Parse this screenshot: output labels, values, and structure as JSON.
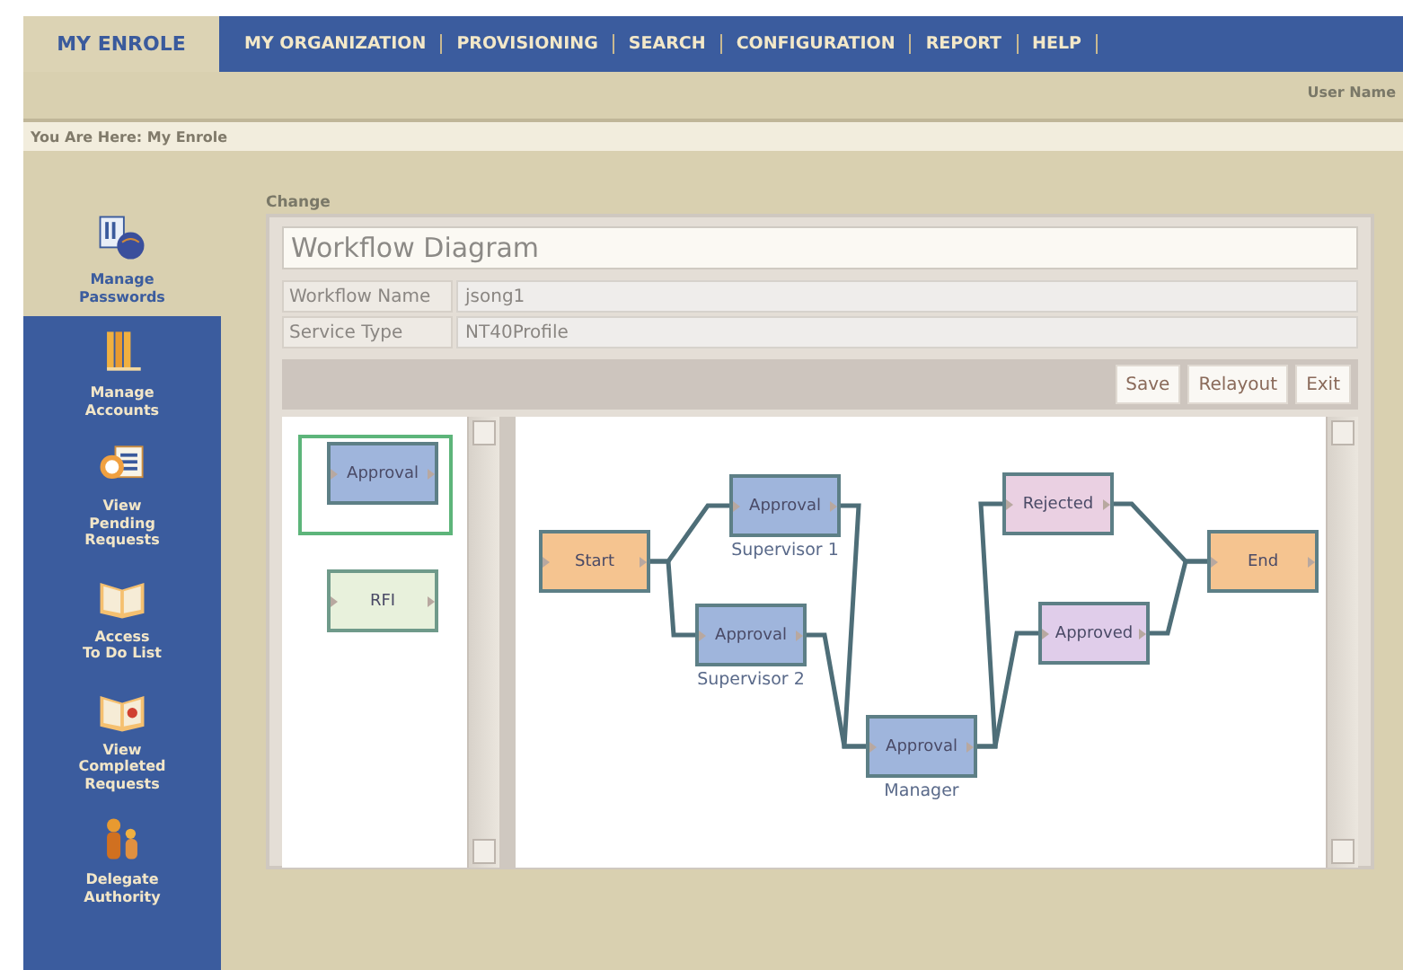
{
  "header": {
    "logo_tab": "MY ENROLE",
    "nav": [
      "MY ORGANIZATION",
      "PROVISIONING",
      "SEARCH",
      "CONFIGURATION",
      "REPORT",
      "HELP"
    ],
    "user": "User Name"
  },
  "breadcrumb": "You Are Here: My Enrole",
  "sidebar": {
    "items": [
      {
        "label": "Manage\nPasswords",
        "selected": true
      },
      {
        "label": "Manage\nAccounts",
        "selected": false
      },
      {
        "label": "View\nPending\nRequests",
        "selected": false
      },
      {
        "label": "Access\nTo Do List",
        "selected": false
      },
      {
        "label": "View\nCompleted\nRequests",
        "selected": false
      },
      {
        "label": "Delegate\nAuthority",
        "selected": false
      }
    ]
  },
  "page_heading": "Change",
  "workflow": {
    "title": "Workflow Diagram",
    "fields": [
      {
        "label": "Workflow Name",
        "value": "jsong1"
      },
      {
        "label": "Service Type",
        "value": "NT40Profile"
      }
    ],
    "buttons": [
      "Save",
      "Relayout",
      "Exit"
    ],
    "palette": [
      {
        "label": "Approval",
        "kind": "approval",
        "selected": true
      },
      {
        "label": "RFI",
        "kind": "rfi",
        "selected": false
      }
    ],
    "nodes": [
      {
        "label": "Start",
        "kind": "start"
      },
      {
        "label": "Approval",
        "kind": "approval",
        "caption": "Supervisor 1"
      },
      {
        "label": "Approval",
        "kind": "approval",
        "caption": "Supervisor 2"
      },
      {
        "label": "Approval",
        "kind": "approval",
        "caption": "Manager"
      },
      {
        "label": "Rejected",
        "kind": "rejected"
      },
      {
        "label": "Approved",
        "kind": "approved"
      },
      {
        "label": "End",
        "kind": "end"
      }
    ]
  }
}
